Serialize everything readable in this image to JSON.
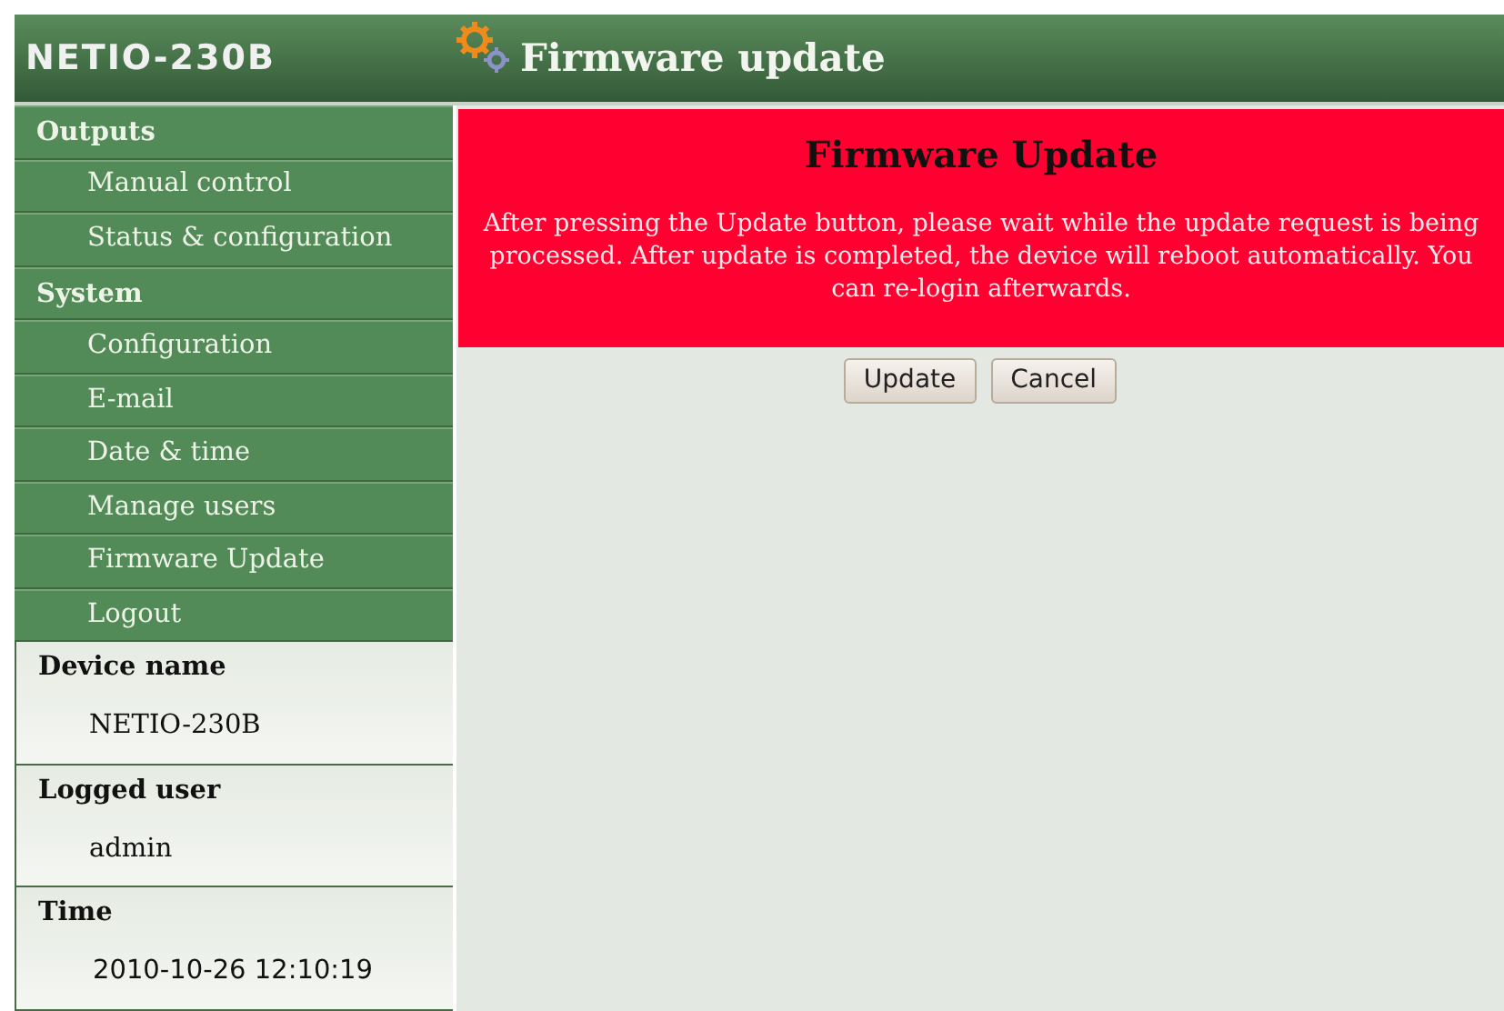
{
  "header": {
    "logo": "NETIO-230B",
    "title": "Firmware update"
  },
  "menu": [
    {
      "kind": "section",
      "label": "Outputs"
    },
    {
      "kind": "link",
      "label": "Manual control"
    },
    {
      "kind": "link",
      "label": "Status & configuration"
    },
    {
      "kind": "section",
      "label": "System"
    },
    {
      "kind": "link",
      "label": "Configuration"
    },
    {
      "kind": "link",
      "label": "E-mail"
    },
    {
      "kind": "link",
      "label": "Date & time"
    },
    {
      "kind": "link",
      "label": "Manage users"
    },
    {
      "kind": "link",
      "label": "Firmware Update"
    },
    {
      "kind": "link",
      "label": "Logout"
    }
  ],
  "info": [
    {
      "label": "Device name",
      "value": "NETIO-230B"
    },
    {
      "label": "Logged user",
      "value": "admin"
    },
    {
      "label": "Time",
      "value": "2010-10-26 12:10:19"
    }
  ],
  "notice": {
    "title": "Firmware Update",
    "text": "After pressing the Update button, please wait while the update request is being processed. After update is completed, the device will reboot automatically. You can re-login afterwards."
  },
  "buttons": [
    "Update",
    "Cancel"
  ]
}
